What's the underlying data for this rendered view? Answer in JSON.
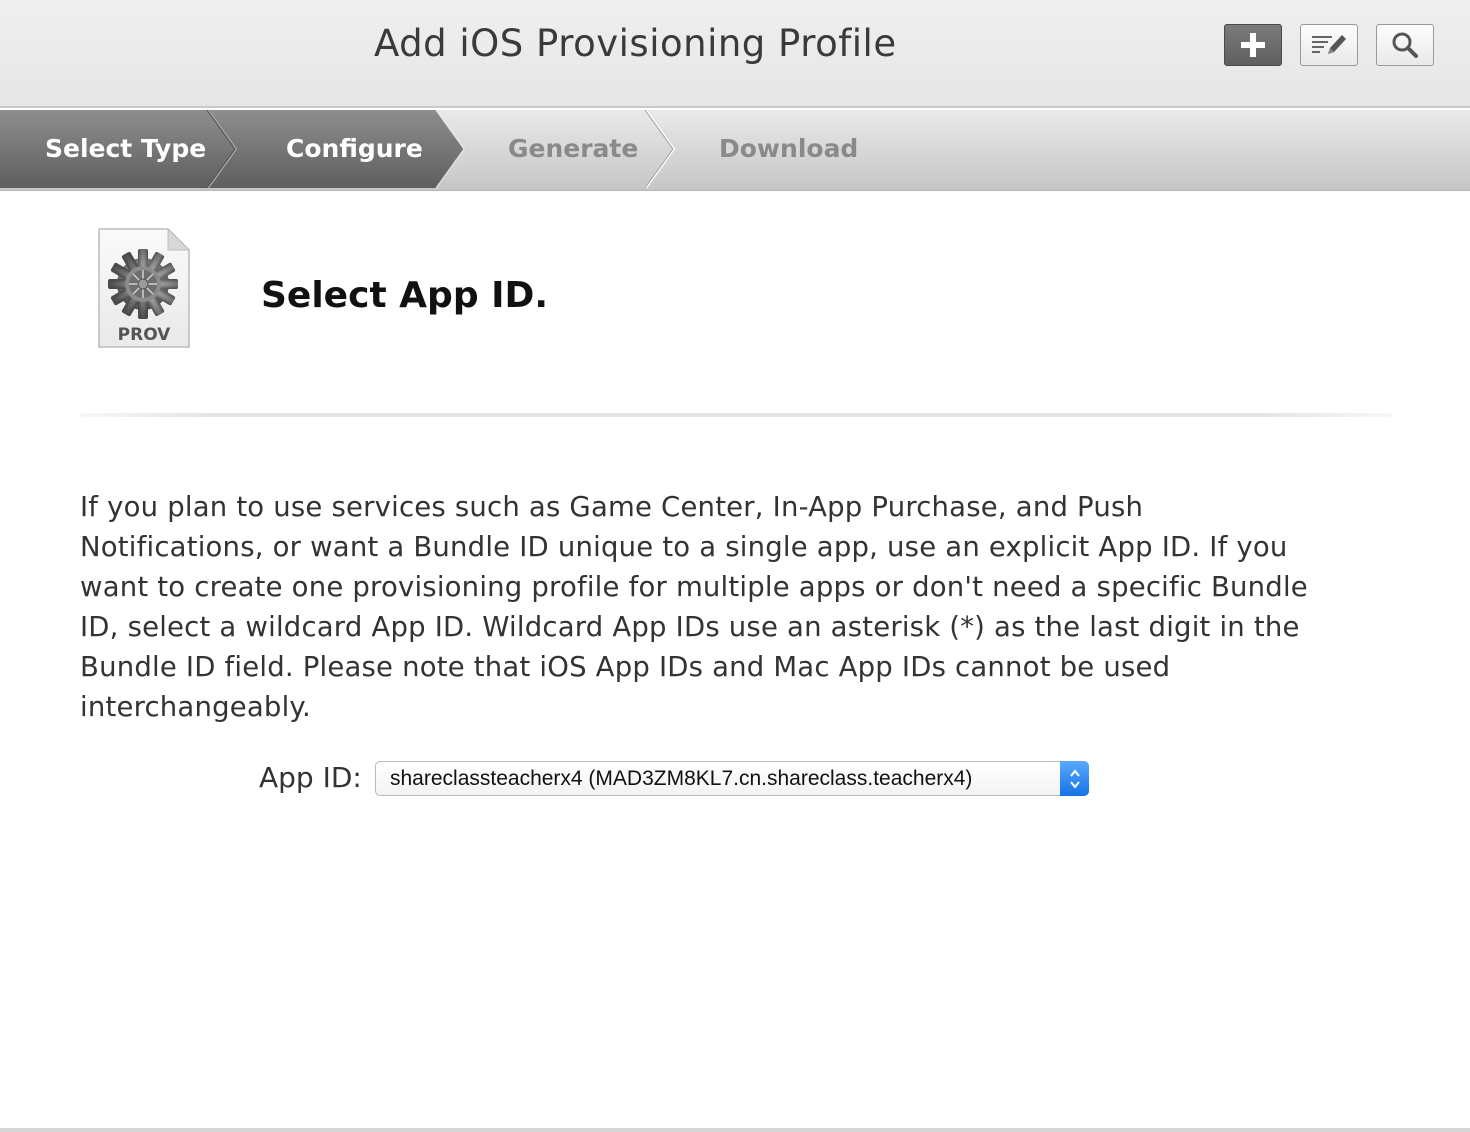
{
  "header": {
    "title": "Add iOS Provisioning Profile",
    "buttons": [
      {
        "name": "add",
        "icon": "plus-icon",
        "active": true
      },
      {
        "name": "edit",
        "icon": "edit-icon",
        "active": false
      },
      {
        "name": "search",
        "icon": "search-icon",
        "active": false
      }
    ]
  },
  "steps": [
    {
      "label": "Select Type",
      "state": "done"
    },
    {
      "label": "Configure",
      "state": "current"
    },
    {
      "label": "Generate",
      "state": "todo"
    },
    {
      "label": "Download",
      "state": "todo"
    }
  ],
  "main": {
    "icon_label": "PROV",
    "icon": "provisioning-profile-gear-icon",
    "title": "Select App ID.",
    "description": "If you plan to use services such as Game Center, In-App Purchase, and Push Notifications, or want a Bundle ID unique to a single app, use an explicit App ID. If you want to create one provisioning profile for multiple apps or don't need a specific Bundle ID, select a wildcard App ID. Wildcard App IDs use an asterisk (*) as the last digit in the Bundle ID field. Please note that iOS App IDs and Mac App IDs cannot be used interchangeably.",
    "app_id": {
      "label": "App ID:",
      "selected": "shareclassteacherx4 (MAD3ZM8KL7.cn.shareclass.teacherx4)"
    }
  },
  "colors": {
    "accent_blue": "#1473e6",
    "step_done": "#6a6a6a",
    "step_todo_text": "#8a8a8a"
  }
}
